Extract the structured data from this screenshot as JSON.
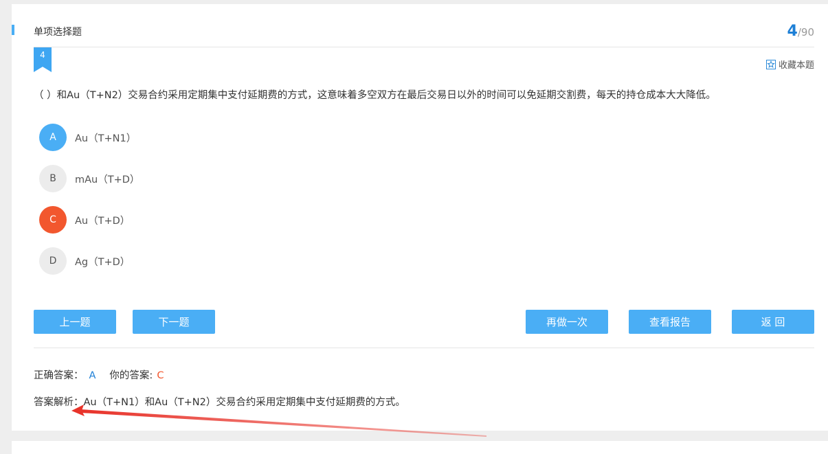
{
  "header": {
    "question_type": "单项选择题",
    "current": "4",
    "total": "/90",
    "badge_number": "4",
    "favorite_label": "收藏本题"
  },
  "question": {
    "text": "（ ）和Au（T+N2）交易合约采用定期集中支付延期费的方式，这意味着多空双方在最后交易日以外的时间可以免延期交割费，每天的持仓成本大大降低。"
  },
  "options": [
    {
      "letter": "A",
      "text": "Au（T+N1）",
      "state": "correct"
    },
    {
      "letter": "B",
      "text": "mAu（T+D）",
      "state": "normal"
    },
    {
      "letter": "C",
      "text": "Au（T+D）",
      "state": "wrong"
    },
    {
      "letter": "D",
      "text": "Ag（T+D）",
      "state": "normal"
    }
  ],
  "buttons": {
    "prev": "上一题",
    "next": "下一题",
    "redo": "再做一次",
    "report": "查看报告",
    "back": "返 回"
  },
  "result": {
    "correct_label": "正确答案：",
    "correct_value": "A",
    "your_label": "你的答案:",
    "your_value": "C"
  },
  "analysis": {
    "label": "答案解析：",
    "text": "Au（T+N1）和Au（T+N2）交易合约采用定期集中支付延期费的方式。"
  },
  "colors": {
    "accent": "#4aaef5",
    "correct": "#1d7fd6",
    "wrong": "#f2572e",
    "annotation_arrow": "#e8332a"
  }
}
